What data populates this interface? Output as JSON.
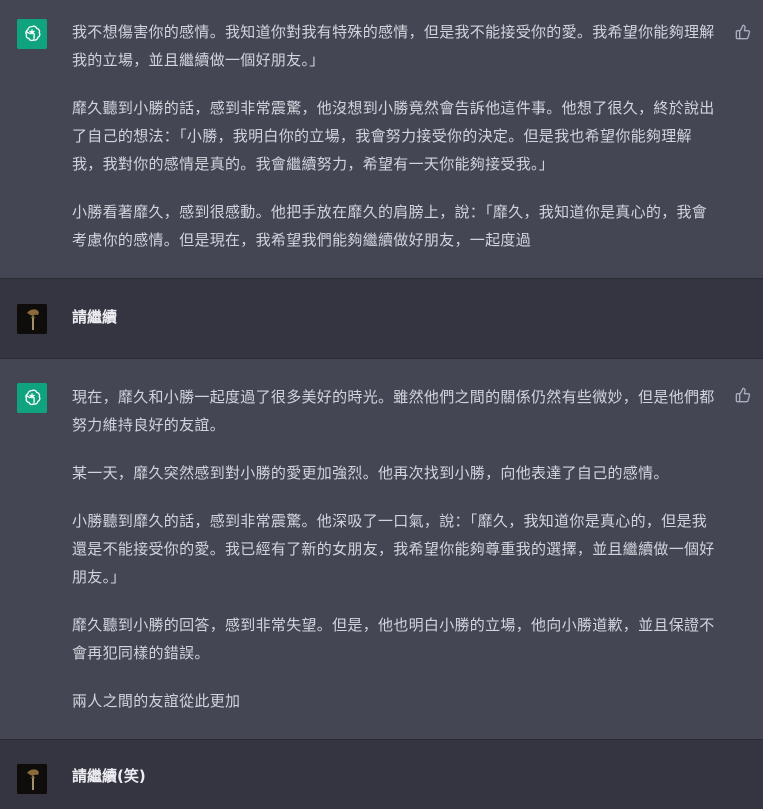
{
  "thread": {
    "messages": [
      {
        "role": "assistant",
        "paragraphs": [
          "我不想傷害你的感情。我知道你對我有特殊的感情，但是我不能接受你的愛。我希望你能夠理解我的立場，並且繼續做一個好朋友。」",
          "靡久聽到小勝的話，感到非常震驚，他沒想到小勝竟然會告訴他這件事。他想了很久，終於說出了自己的想法：「小勝，我明白你的立場，我會努力接受你的決定。但是我也希望你能夠理解我，我對你的感情是真的。我會繼續努力，希望有一天你能夠接受我。」",
          "小勝看著靡久，感到很感動。他把手放在靡久的肩膀上，說：「靡久，我知道你是真心的，我會考慮你的感情。但是現在，我希望我們能夠繼續做好朋友，一起度過"
        ]
      },
      {
        "role": "user",
        "text": "請繼續"
      },
      {
        "role": "assistant",
        "paragraphs": [
          "現在，靡久和小勝一起度過了很多美好的時光。雖然他們之間的關係仍然有些微妙，但是他們都努力維持良好的友誼。",
          "某一天，靡久突然感到對小勝的愛更加強烈。他再次找到小勝，向他表達了自己的感情。",
          "小勝聽到靡久的話，感到非常震驚。他深吸了一口氣，說：「靡久，我知道你是真心的，但是我還是不能接受你的愛。我已經有了新的女朋友，我希望你能夠尊重我的選擇，並且繼續做一個好朋友。」",
          "靡久聽到小勝的回答，感到非常失望。但是，他也明白小勝的立場，他向小勝道歉，並且保證不會再犯同樣的錯誤。",
          "兩人之間的友誼從此更加"
        ]
      },
      {
        "role": "user",
        "text": "請繼續(笑)"
      }
    ]
  },
  "icons": {
    "assistant_avatar": "openai-logo-icon",
    "user_avatar": "user-avatar-photo",
    "feedback": "thumbs-up-icon"
  },
  "colors": {
    "assistant_bg": "#444654",
    "user_bg": "#343541",
    "logo_bg": "#10a37f",
    "text": "#d1d5db"
  }
}
